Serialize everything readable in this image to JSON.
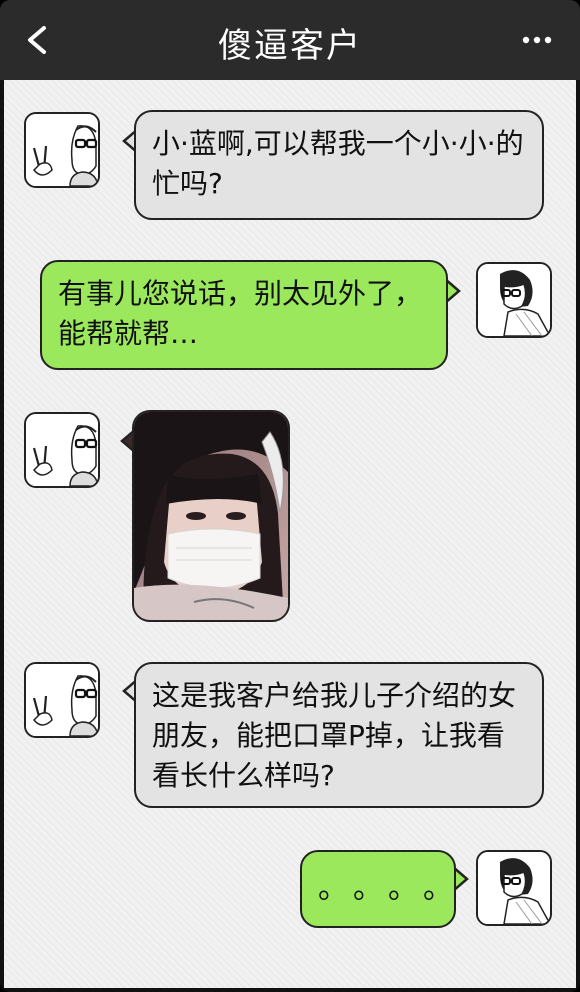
{
  "header": {
    "title": "傻逼客户",
    "back_icon": "chevron-left-icon",
    "more_icon": "more-dots-icon"
  },
  "messages": [
    {
      "side": "in",
      "type": "text",
      "text": "小·蓝啊,可以帮我一个小·小·的忙吗?"
    },
    {
      "side": "out",
      "type": "text",
      "text": "有事儿您说话，别太见外了，能帮就帮…"
    },
    {
      "side": "in",
      "type": "image",
      "image": "masked-girl-photo"
    },
    {
      "side": "in",
      "type": "text",
      "text": "这是我客户给我儿子介绍的女朋友，能把口罩P掉，让我看看长什么样吗?"
    },
    {
      "side": "out",
      "type": "text",
      "text": "。。。。"
    }
  ],
  "colors": {
    "header_bg": "#2b2b2b",
    "incoming_bubble": "#e4e3e4",
    "outgoing_bubble": "#9be85d"
  }
}
